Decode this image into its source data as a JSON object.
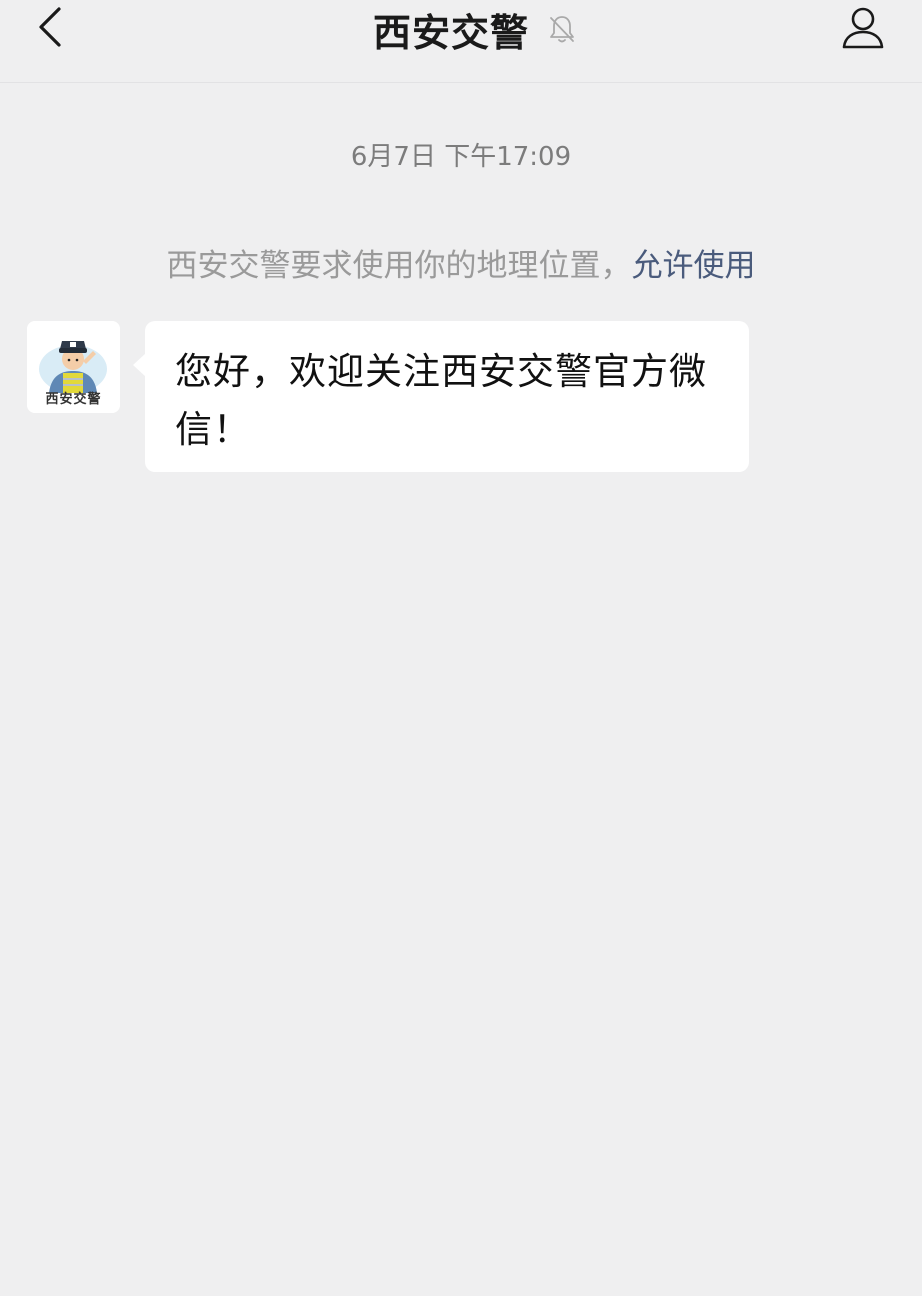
{
  "header": {
    "title": "西安交警",
    "back_icon": "chevron-left-icon",
    "mute_icon": "bell-off-icon",
    "profile_icon": "person-icon"
  },
  "chat": {
    "timestamp": "6月7日 下午17:09",
    "system_message": {
      "text": "西安交警要求使用你的地理位置，",
      "link": "允许使用"
    },
    "messages": [
      {
        "sender_avatar_caption": "西安交警",
        "text": "您好，欢迎关注西安交警官方微信！"
      }
    ]
  }
}
